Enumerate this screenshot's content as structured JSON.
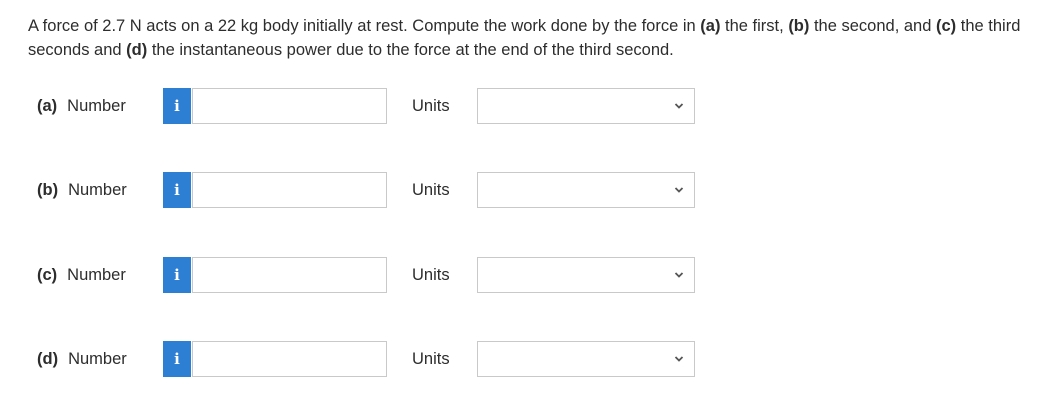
{
  "question": {
    "t1": "A force of 2.7 N acts on a 22 kg body initially at rest. Compute the work done by the force in ",
    "a": "(a)",
    "t2": " the first, ",
    "b": "(b)",
    "t3": " the second, and ",
    "c": "(c)",
    "t4": " the third seconds and ",
    "d": "(d)",
    "t5": " the instantaneous power due to the force at the end of the third second."
  },
  "parts": [
    {
      "letter": "(a)",
      "label": "Number",
      "info_icon": "i",
      "value": "",
      "units_label": "Units",
      "units_value": ""
    },
    {
      "letter": "(b)",
      "label": "Number",
      "info_icon": "i",
      "value": "",
      "units_label": "Units",
      "units_value": ""
    },
    {
      "letter": "(c)",
      "label": "Number",
      "info_icon": "i",
      "value": "",
      "units_label": "Units",
      "units_value": ""
    },
    {
      "letter": "(d)",
      "label": "Number",
      "info_icon": "i",
      "value": "",
      "units_label": "Units",
      "units_value": ""
    }
  ],
  "colors": {
    "info_icon_bg": "#2d7fd3",
    "input_border": "#c9c9c9",
    "text": "#2d2d2d"
  },
  "icons": {
    "info": "info-icon",
    "dropdown": "chevron-down-icon"
  }
}
